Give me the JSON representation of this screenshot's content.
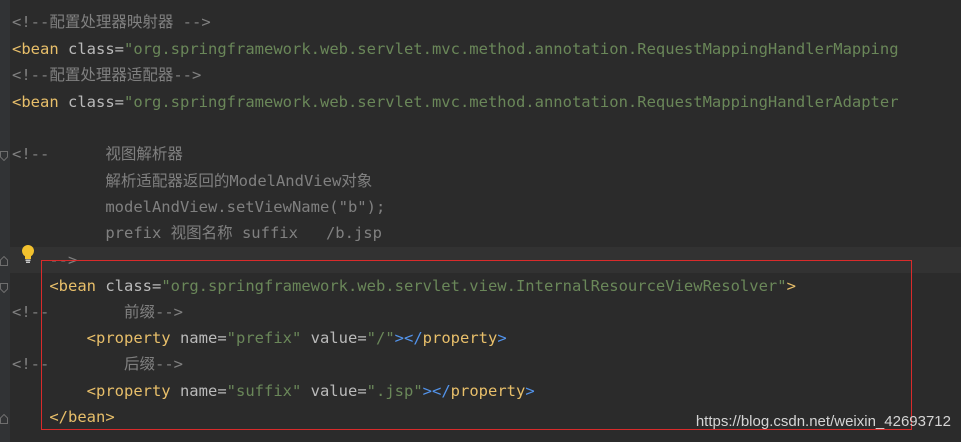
{
  "editor": {
    "lines": [
      {
        "parts": [
          {
            "cls": "c-comment",
            "text": "<!--配置处理器映射器 -->"
          }
        ]
      },
      {
        "parts": [
          {
            "cls": "c-tag",
            "text": "<bean"
          },
          {
            "cls": "c-attr",
            "text": " class"
          },
          {
            "cls": "c-attr",
            "text": "="
          },
          {
            "cls": "c-val",
            "text": "\"org.springframework.web.servlet.mvc.method.annotation.RequestMappingHandlerMapping"
          }
        ]
      },
      {
        "parts": [
          {
            "cls": "c-comment",
            "text": "<!--配置处理器适配器-->"
          }
        ]
      },
      {
        "parts": [
          {
            "cls": "c-tag",
            "text": "<bean"
          },
          {
            "cls": "c-attr",
            "text": " class"
          },
          {
            "cls": "c-attr",
            "text": "="
          },
          {
            "cls": "c-val",
            "text": "\"org.springframework.web.servlet.mvc.method.annotation.RequestMappingHandlerAdapter"
          }
        ]
      },
      {
        "parts": [
          {
            "cls": "c-comment",
            "text": ""
          }
        ]
      },
      {
        "parts": [
          {
            "cls": "c-comment",
            "text": "<!--      视图解析器"
          }
        ]
      },
      {
        "parts": [
          {
            "cls": "c-comment",
            "text": "          解析适配器返回的ModelAndView对象"
          }
        ]
      },
      {
        "parts": [
          {
            "cls": "c-comment",
            "text": "          modelAndView.setViewName(\"b\");"
          }
        ]
      },
      {
        "parts": [
          {
            "cls": "c-comment",
            "text": "          prefix 视图名称 suffix   /b.jsp"
          }
        ]
      },
      {
        "parts": [
          {
            "cls": "c-comment",
            "text": "    -->"
          }
        ]
      },
      {
        "parts": [
          {
            "cls": "c-tag",
            "text": "    <bean"
          },
          {
            "cls": "c-attr",
            "text": " class"
          },
          {
            "cls": "c-attr",
            "text": "="
          },
          {
            "cls": "c-val",
            "text": "\"org.springframework.web.servlet.view.InternalResourceViewResolver\""
          },
          {
            "cls": "c-tag",
            "text": ">"
          }
        ]
      },
      {
        "parts": [
          {
            "cls": "c-comment",
            "text": "<!--        前缀-->"
          }
        ]
      },
      {
        "parts": [
          {
            "cls": "c-tag",
            "text": "        <property"
          },
          {
            "cls": "c-attr",
            "text": " name"
          },
          {
            "cls": "c-attr",
            "text": "="
          },
          {
            "cls": "c-val",
            "text": "\"prefix\""
          },
          {
            "cls": "c-attr",
            "text": " value"
          },
          {
            "cls": "c-attr",
            "text": "="
          },
          {
            "cls": "c-val",
            "text": "\"/\""
          },
          {
            "cls": "c-blue",
            "text": "></"
          },
          {
            "cls": "c-tag",
            "text": "property"
          },
          {
            "cls": "c-blue",
            "text": ">"
          }
        ]
      },
      {
        "parts": [
          {
            "cls": "c-comment",
            "text": "<!--        后缀-->"
          }
        ]
      },
      {
        "parts": [
          {
            "cls": "c-tag",
            "text": "        <property"
          },
          {
            "cls": "c-attr",
            "text": " name"
          },
          {
            "cls": "c-attr",
            "text": "="
          },
          {
            "cls": "c-val",
            "text": "\"suffix\""
          },
          {
            "cls": "c-attr",
            "text": " value"
          },
          {
            "cls": "c-attr",
            "text": "="
          },
          {
            "cls": "c-val",
            "text": "\".jsp\""
          },
          {
            "cls": "c-blue",
            "text": "></"
          },
          {
            "cls": "c-tag",
            "text": "property"
          },
          {
            "cls": "c-blue",
            "text": ">"
          }
        ]
      },
      {
        "parts": [
          {
            "cls": "c-tag",
            "text": "    </bean>"
          }
        ]
      }
    ]
  },
  "watermark": "https://blog.csdn.net/weixin_42693712",
  "colors": {
    "background": "#2b2b2b",
    "comment": "#808080",
    "tag": "#e8bf6a",
    "attribute": "#bababa",
    "string": "#6a8759",
    "highlight_box": "#d92b2b"
  },
  "icons": {
    "bulb": "lightbulb-icon",
    "fold": "fold-marker-icon"
  }
}
